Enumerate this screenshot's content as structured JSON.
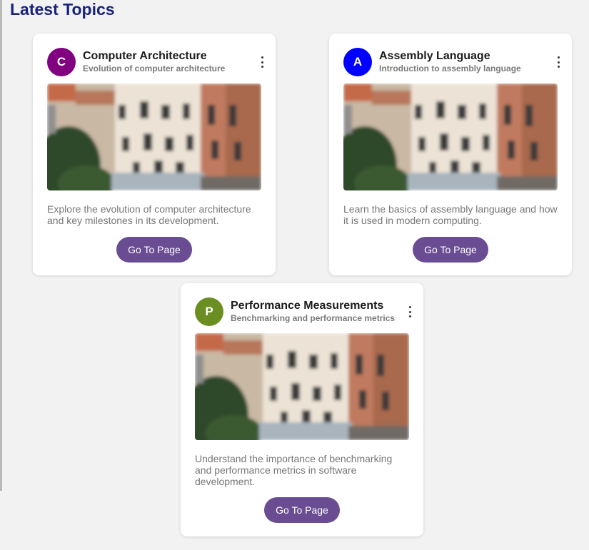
{
  "section": {
    "title": "Latest Topics"
  },
  "cards": [
    {
      "avatar_letter": "C",
      "avatar_color": "#800080",
      "title": "Computer Architecture",
      "subtitle": "Evolution of computer architecture",
      "description": "Explore the evolution of computer architecture and key milestones in its development.",
      "button_label": "Go To Page",
      "menu_icon": "more-vert-icon",
      "image": "building-photo"
    },
    {
      "avatar_letter": "A",
      "avatar_color": "#0000ff",
      "title": "Assembly Language",
      "subtitle": "Introduction to assembly language",
      "description": "Learn the basics of assembly language and how it is used in modern computing.",
      "button_label": "Go To Page",
      "menu_icon": "more-vert-icon",
      "image": "building-photo"
    },
    {
      "avatar_letter": "P",
      "avatar_color": "#6b8e23",
      "title": "Performance Measurements",
      "subtitle": "Benchmarking and performance metrics",
      "description": "Understand the importance of benchmarking and performance metrics in software development.",
      "button_label": "Go To Page",
      "menu_icon": "more-vert-icon",
      "image": "building-photo"
    }
  ],
  "colors": {
    "title": "#1a237e",
    "button": "#6a4c93",
    "background": "#f2f2f2"
  }
}
